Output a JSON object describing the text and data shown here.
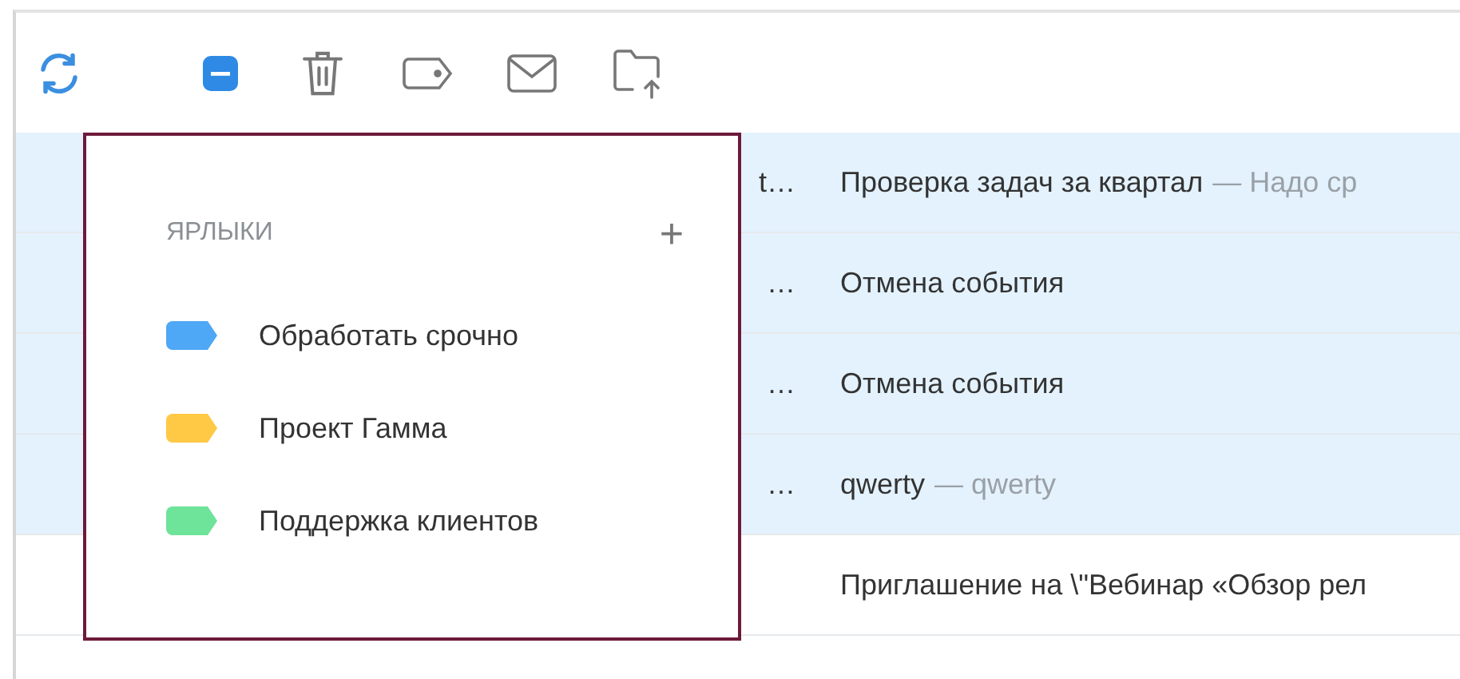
{
  "toolbar": {
    "select_all": {
      "indeterminate": true
    }
  },
  "messages": [
    {
      "sender": "t…",
      "subject": "Проверка задач за квартал",
      "preview": "— Надо ср",
      "selected": true
    },
    {
      "sender": "…",
      "subject": "Отмена события",
      "selected": true
    },
    {
      "sender": "…",
      "subject": "Отмена события",
      "selected": true
    },
    {
      "sender": "…",
      "subject": "qwerty",
      "preview": "— qwerty",
      "selected": true
    },
    {
      "subject": "Приглашение на \\\"Вебинар «Обзор рел",
      "selected": false
    }
  ],
  "labels_menu": {
    "title": "ЯРЛЫКИ",
    "add": "+",
    "labels": [
      {
        "name": "Обработать срочно",
        "color": "#4ea8f5"
      },
      {
        "name": "Проект Гамма",
        "color": "#ffc845"
      },
      {
        "name": "Поддержка клиентов",
        "color": "#6ee39a"
      }
    ]
  }
}
